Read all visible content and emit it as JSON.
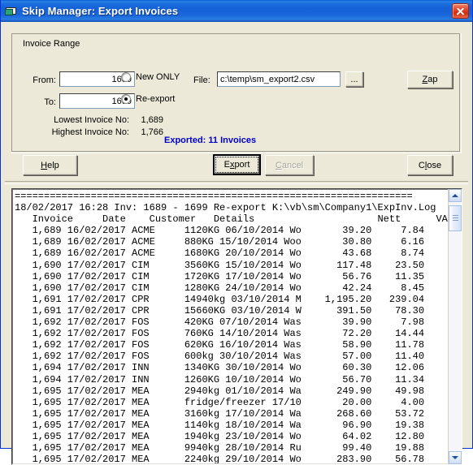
{
  "window": {
    "title": "Skip Manager: Export Invoices",
    "icon": "folder-disk-icon",
    "close_label": "Close window",
    "accent_titlebar": "#1560d8",
    "face_color": "#ece9d8"
  },
  "group": {
    "legend": "Invoice Range"
  },
  "form": {
    "from_label": "From:",
    "from_value": "1689",
    "to_label": "To:",
    "to_value": "1699",
    "lowest_label": "Lowest Invoice No:",
    "lowest_value": "1,689",
    "highest_label": "Highest Invoice No:",
    "highest_value": "1,766",
    "radio_new_only": "New ONLY",
    "radio_re_export": "Re-export",
    "selected_mode": "Re-export",
    "file_label": "File:",
    "file_value": "c:\\temp\\sm_export2.csv",
    "browse_label": "...",
    "zap_label": "Zap",
    "zap_accesskey": "Z"
  },
  "status": {
    "text": "Exported: 11 Invoices",
    "color": "#0000cd"
  },
  "buttons": {
    "help": {
      "label": "Help",
      "accesskey": "H",
      "enabled": true
    },
    "export": {
      "label": "Export",
      "accesskey": "x",
      "enabled": true,
      "focused": true
    },
    "cancel": {
      "label": "Cancel",
      "accesskey": "C",
      "enabled": false
    },
    "close": {
      "label": "Close",
      "accesskey": "l",
      "enabled": true
    }
  },
  "log": {
    "rule": "====================================================================",
    "header_line": "18/02/2017 16:28 Inv: 1689 - 1699 Re-export K:\\vb\\sm\\Company1\\ExpInv.Log",
    "columns": [
      "Invoice",
      "Date",
      "Customer",
      "Details",
      "Nett",
      "VAT"
    ],
    "column_header_line": "   Invoice     Date    Customer   Details                     Nett      VAT",
    "rows": [
      {
        "invoice": "1,689",
        "date": "16/02/2017",
        "customer": "ACME",
        "details": "1120KG 06/10/2014 Wo",
        "nett": "39.20",
        "vat": "7.84"
      },
      {
        "invoice": "1,689",
        "date": "16/02/2017",
        "customer": "ACME",
        "details": "880KG 15/10/2014 Woo",
        "nett": "30.80",
        "vat": "6.16"
      },
      {
        "invoice": "1,689",
        "date": "16/02/2017",
        "customer": "ACME",
        "details": "1680KG 20/10/2014 Wo",
        "nett": "43.68",
        "vat": "8.74"
      },
      {
        "invoice": "1,690",
        "date": "17/02/2017",
        "customer": "CIM",
        "details": "3560KG 15/10/2014 Wo",
        "nett": "117.48",
        "vat": "23.50"
      },
      {
        "invoice": "1,690",
        "date": "17/02/2017",
        "customer": "CIM",
        "details": "1720KG 17/10/2014 Wo",
        "nett": "56.76",
        "vat": "11.35"
      },
      {
        "invoice": "1,690",
        "date": "17/02/2017",
        "customer": "CIM",
        "details": "1280KG 24/10/2014 Wo",
        "nett": "42.24",
        "vat": "8.45"
      },
      {
        "invoice": "1,691",
        "date": "17/02/2017",
        "customer": "CPR",
        "details": "14940kg 03/10/2014 M",
        "nett": "1,195.20",
        "vat": "239.04"
      },
      {
        "invoice": "1,691",
        "date": "17/02/2017",
        "customer": "CPR",
        "details": "15660KG 03/10/2014 W",
        "nett": "391.50",
        "vat": "78.30"
      },
      {
        "invoice": "1,692",
        "date": "17/02/2017",
        "customer": "FOS",
        "details": "420KG 07/10/2014 Was",
        "nett": "39.90",
        "vat": "7.98"
      },
      {
        "invoice": "1,692",
        "date": "17/02/2017",
        "customer": "FOS",
        "details": "760KG 14/10/2014 Was",
        "nett": "72.20",
        "vat": "14.44"
      },
      {
        "invoice": "1,692",
        "date": "17/02/2017",
        "customer": "FOS",
        "details": "620KG 16/10/2014 Was",
        "nett": "58.90",
        "vat": "11.78"
      },
      {
        "invoice": "1,692",
        "date": "17/02/2017",
        "customer": "FOS",
        "details": "600kg 30/10/2014 Was",
        "nett": "57.00",
        "vat": "11.40"
      },
      {
        "invoice": "1,694",
        "date": "17/02/2017",
        "customer": "INN",
        "details": "1340KG 30/10/2014 Wo",
        "nett": "60.30",
        "vat": "12.06"
      },
      {
        "invoice": "1,694",
        "date": "17/02/2017",
        "customer": "INN",
        "details": "1260KG 10/10/2014 Wo",
        "nett": "56.70",
        "vat": "11.34"
      },
      {
        "invoice": "1,695",
        "date": "17/02/2017",
        "customer": "MEA",
        "details": "2940kg 01/10/2014 Wa",
        "nett": "249.90",
        "vat": "49.98"
      },
      {
        "invoice": "1,695",
        "date": "17/02/2017",
        "customer": "MEA",
        "details": "fridge/freezer 17/10",
        "nett": "20.00",
        "vat": "4.00"
      },
      {
        "invoice": "1,695",
        "date": "17/02/2017",
        "customer": "MEA",
        "details": "3160kg 17/10/2014 Wa",
        "nett": "268.60",
        "vat": "53.72"
      },
      {
        "invoice": "1,695",
        "date": "17/02/2017",
        "customer": "MEA",
        "details": "1140kg 18/10/2014 Wa",
        "nett": "96.90",
        "vat": "19.38"
      },
      {
        "invoice": "1,695",
        "date": "17/02/2017",
        "customer": "MEA",
        "details": "1940kg 23/10/2014 Wo",
        "nett": "64.02",
        "vat": "12.80"
      },
      {
        "invoice": "1,695",
        "date": "17/02/2017",
        "customer": "MEA",
        "details": "9940kg 28/10/2014 Ru",
        "nett": "99.40",
        "vat": "19.88"
      },
      {
        "invoice": "1,695",
        "date": "17/02/2017",
        "customer": "MEA",
        "details": "2240kg 29/10/2014 Wo",
        "nett": "283.90",
        "vat": "56.78"
      }
    ]
  },
  "scrollbar": {
    "up_label": "Scroll up",
    "down_label": "Scroll down",
    "position_pct": 2
  }
}
